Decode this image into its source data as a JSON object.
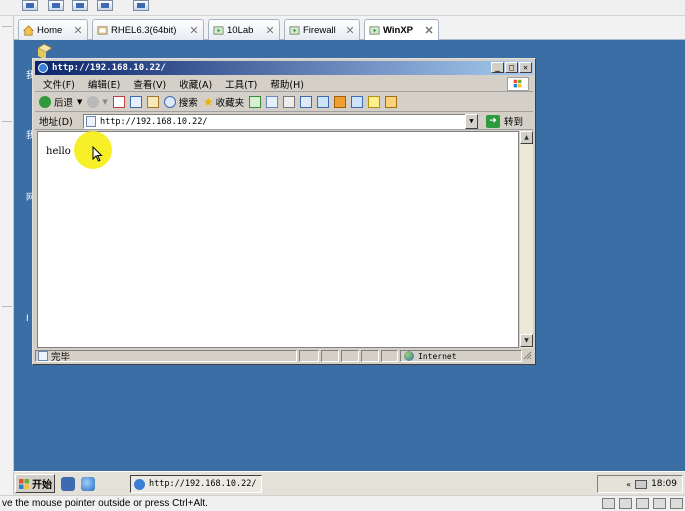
{
  "host": {
    "tabs": [
      {
        "label": "Home",
        "icon": "home-icon"
      },
      {
        "label": "RHEL6.3(64bit)",
        "icon": "vm-icon"
      },
      {
        "label": "10Lab",
        "icon": "vm-running-icon"
      },
      {
        "label": "Firewall",
        "icon": "vm-running-icon"
      },
      {
        "label": "WinXP",
        "icon": "vm-running-icon",
        "active": true
      }
    ],
    "status_message": "ve the mouse pointer outside or press Ctrl+Alt."
  },
  "ie": {
    "title": "http://192.168.10.22/",
    "menu": [
      "文件(F)",
      "编辑(E)",
      "查看(V)",
      "收藏(A)",
      "工具(T)",
      "帮助(H)"
    ],
    "toolbar": {
      "back": "后退",
      "search": "搜索",
      "favorites": "收藏夹"
    },
    "address_label": "地址(D)",
    "address_value": "http://192.168.10.22/",
    "go_label": "转到",
    "content_text": "hello",
    "status_text": "完毕",
    "zone_text": "Internet"
  },
  "guest_taskbar": {
    "start_label": "开始",
    "task_button": "http://192.168.10.22/",
    "clock": "18:09"
  },
  "colors": {
    "desktop": "#3a6ea5",
    "title_bar": "#0a246a",
    "cursor_highlight": "#f7ef1c"
  }
}
